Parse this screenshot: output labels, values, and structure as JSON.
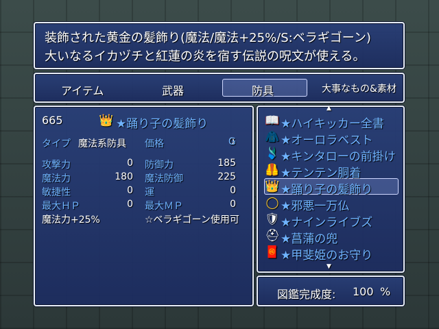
{
  "help": {
    "line1": "装飾された黄金の髪飾り(魔法/魔法+25%/S:ベラギゴーン)",
    "line2": "大いなるイカヅチと紅蓮の炎を宿す伝説の呪文が使える。"
  },
  "tabs": [
    "アイテム",
    "武器",
    "防具",
    "大事なもの&素材"
  ],
  "selected_tab": "防具",
  "detail": {
    "count": "665",
    "item_icon": "gold-hairpin-icon",
    "item_name": "★踊り子の髪飾り",
    "type_label": "タイプ",
    "type_value": "魔法系防具",
    "price_label": "価格",
    "price_value": "0",
    "price_unit": "G",
    "stats": [
      {
        "label": "攻撃力",
        "value": "0"
      },
      {
        "label": "防御力",
        "value": "185"
      },
      {
        "label": "魔法力",
        "value": "180"
      },
      {
        "label": "魔法防御",
        "value": "225"
      },
      {
        "label": "敏捷性",
        "value": "0"
      },
      {
        "label": "運",
        "value": "0"
      },
      {
        "label": "最大ＨＰ",
        "value": "0"
      },
      {
        "label": "最大ＭＰ",
        "value": "0"
      }
    ],
    "effect1": "魔法力+25%",
    "effect2": "☆ベラギゴーン使用可"
  },
  "list": [
    {
      "icon": "book-icon",
      "glyph": "📖",
      "name": "★ハイキッカー全書"
    },
    {
      "icon": "aurora-vest-icon",
      "glyph": "🧥",
      "name": "★オーロラベスト"
    },
    {
      "icon": "apron-icon",
      "glyph": "🩱",
      "name": "★キンタローの前掛け"
    },
    {
      "icon": "red-vest-icon",
      "glyph": "🦺",
      "name": "★テンテン胴着"
    },
    {
      "icon": "gold-hairpin-icon",
      "glyph": "👑",
      "name": "★踊り子の髪飾り"
    },
    {
      "icon": "ring-icon",
      "glyph": "◯",
      "name": "★邪悪一万仏"
    },
    {
      "icon": "armor-icon",
      "glyph": "🛡",
      "name": "★ナインライブズ"
    },
    {
      "icon": "helmet-icon",
      "glyph": "⛑",
      "name": "★菖蒲の兜"
    },
    {
      "icon": "charm-icon",
      "glyph": "🧧",
      "name": "★甲斐姫のお守り"
    }
  ],
  "selected_index": 4,
  "completion": {
    "label": "図鑑完成度:",
    "value": "100",
    "unit": "%"
  },
  "colors": {
    "system_text": "#6fb3ff",
    "window_border": "#e8eef8",
    "gold": "#f2c230"
  }
}
